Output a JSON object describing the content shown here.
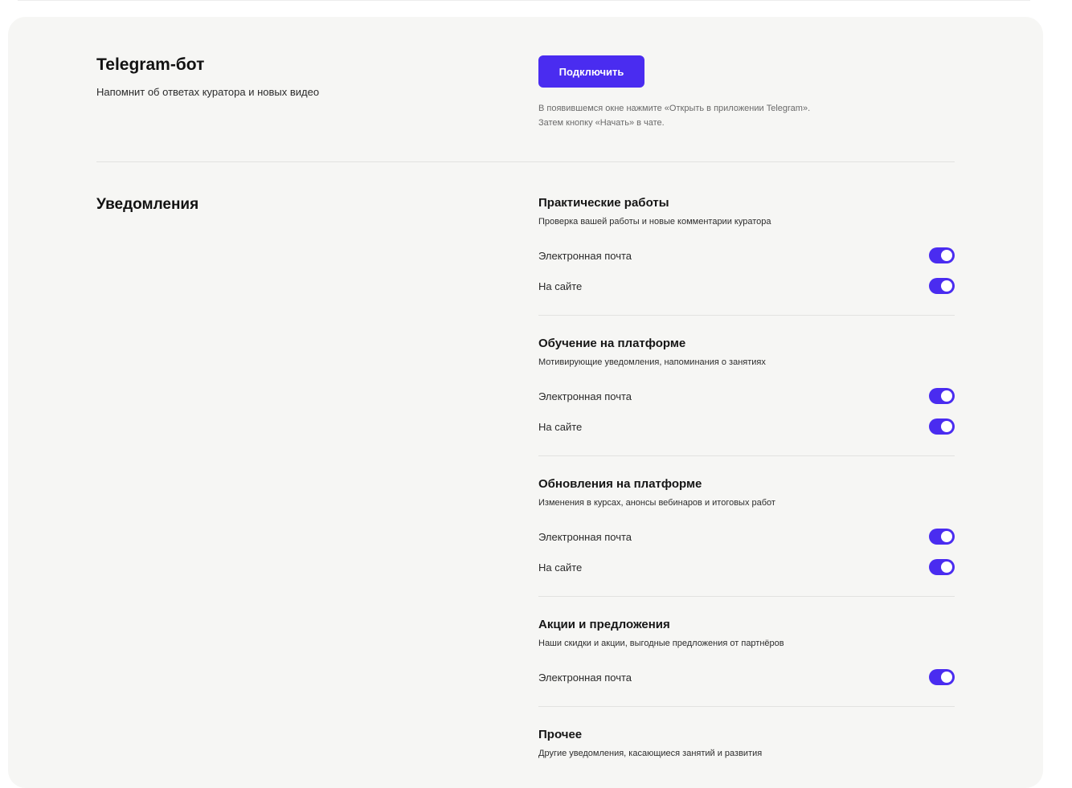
{
  "accent_color": "#4a2cf0",
  "telegram": {
    "title": "Telegram-бот",
    "description": "Напомнит об ответах куратора и новых видео",
    "connect_label": "Подключить",
    "hint_line1": "В появившемся окне нажмите «Открыть в приложении Telegram».",
    "hint_line2": "Затем кнопку «Начать» в чате."
  },
  "notifications": {
    "title": "Уведомления",
    "groups": [
      {
        "title": "Практические работы",
        "description": "Проверка вашей работы и новые комментарии куратора",
        "options": [
          {
            "label": "Электронная почта",
            "enabled": true
          },
          {
            "label": "На сайте",
            "enabled": true
          }
        ]
      },
      {
        "title": "Обучение на платформе",
        "description": "Мотивирующие уведомления, напоминания о занятиях",
        "options": [
          {
            "label": "Электронная почта",
            "enabled": true
          },
          {
            "label": "На сайте",
            "enabled": true
          }
        ]
      },
      {
        "title": "Обновления на платформе",
        "description": "Изменения в курсах, анонсы вебинаров и итоговых работ",
        "options": [
          {
            "label": "Электронная почта",
            "enabled": true
          },
          {
            "label": "На сайте",
            "enabled": true
          }
        ]
      },
      {
        "title": "Акции и предложения",
        "description": "Наши скидки и акции, выгодные предложения от партнёров",
        "options": [
          {
            "label": "Электронная почта",
            "enabled": true
          }
        ]
      },
      {
        "title": "Прочее",
        "description": "Другие уведомления, касающиеся занятий и развития",
        "options": []
      }
    ]
  }
}
